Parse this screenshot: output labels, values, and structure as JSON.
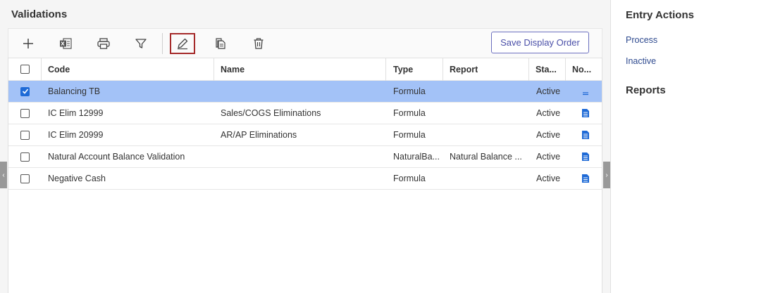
{
  "page": {
    "title": "Validations"
  },
  "toolbar": {
    "buttons": [
      {
        "icon": "plus-icon"
      },
      {
        "icon": "excel-export-icon"
      },
      {
        "icon": "print-icon"
      },
      {
        "icon": "filter-icon"
      },
      {
        "icon": "edit-pencil-icon",
        "selected": true
      },
      {
        "icon": "copy-icon"
      },
      {
        "icon": "delete-icon"
      }
    ],
    "save_display_order": "Save Display Order"
  },
  "grid": {
    "columns": [
      "Code",
      "Name",
      "Type",
      "Report",
      "Sta...",
      "No..."
    ],
    "rows": [
      {
        "code": "Balancing TB",
        "name": "",
        "type": "Formula",
        "report": "",
        "status": "Active",
        "checked": true,
        "note": "notes-icon-empty"
      },
      {
        "code": "IC Elim 12999",
        "name": "Sales/COGS Eliminations",
        "type": "Formula",
        "report": "",
        "status": "Active",
        "checked": false,
        "note": "document-icon"
      },
      {
        "code": "IC Elim 20999",
        "name": "AR/AP Eliminations",
        "type": "Formula",
        "report": "",
        "status": "Active",
        "checked": false,
        "note": "document-icon"
      },
      {
        "code": "Natural Account Balance Validation",
        "name": "",
        "type": "NaturalBa...",
        "report": "Natural Balance ...",
        "status": "Active",
        "checked": false,
        "note": "document-icon"
      },
      {
        "code": "Negative Cash",
        "name": "",
        "type": "Formula",
        "report": "",
        "status": "Active",
        "checked": false,
        "note": "document-icon"
      }
    ]
  },
  "right_panel": {
    "entry_actions_title": "Entry Actions",
    "actions": [
      "Process",
      "Inactive"
    ],
    "reports_title": "Reports"
  },
  "colors": {
    "selection": "#a3c2f7",
    "accent": "#4a4fa8",
    "link": "#2e4a8f",
    "selected_tool_border": "#a52a2a",
    "doc_icon": "#1e6ad6"
  }
}
